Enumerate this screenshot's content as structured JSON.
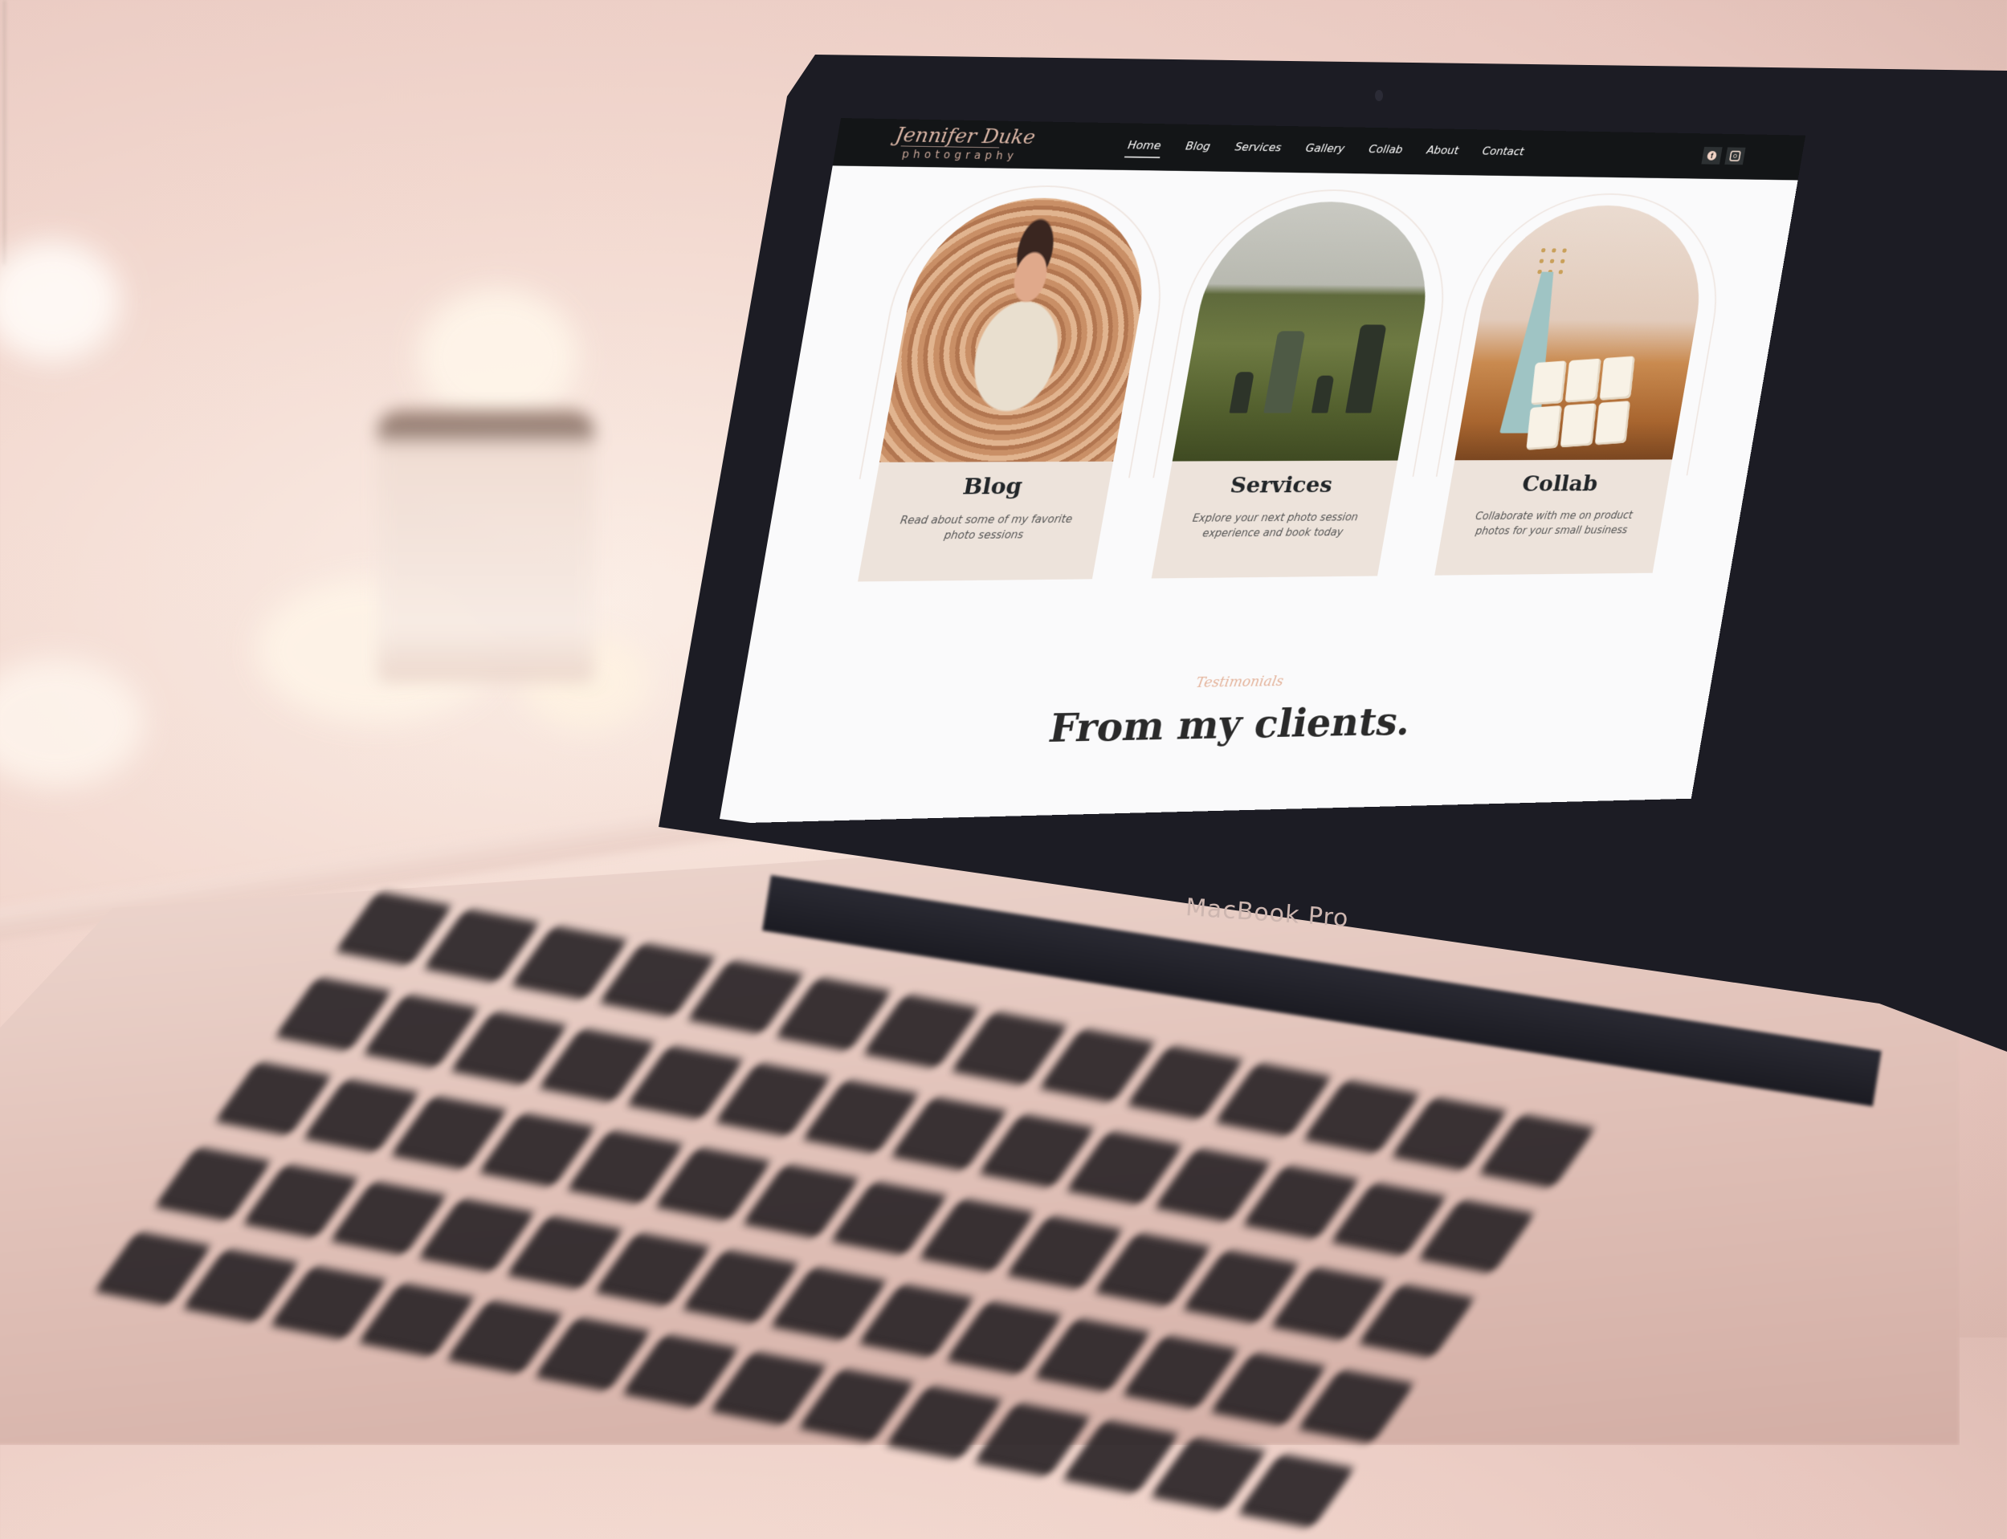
{
  "device": {
    "label": "MacBook Pro"
  },
  "site": {
    "logo": {
      "script": "Jennifer Duke",
      "sub": "photography"
    },
    "nav": {
      "items": [
        {
          "label": "Home",
          "active": true
        },
        {
          "label": "Blog",
          "active": false
        },
        {
          "label": "Services",
          "active": false
        },
        {
          "label": "Gallery",
          "active": false
        },
        {
          "label": "Collab",
          "active": false
        },
        {
          "label": "About",
          "active": false
        },
        {
          "label": "Contact",
          "active": false
        }
      ],
      "socials": [
        {
          "icon": "facebook-icon",
          "glyph": "f"
        },
        {
          "icon": "instagram-icon"
        }
      ]
    },
    "cards": [
      {
        "title": "Blog",
        "description": "Read about some of my favorite photo sessions",
        "image": "newborn-baby-photo"
      },
      {
        "title": "Services",
        "description": "Explore your next photo session experience and book today",
        "image": "family-field-photo"
      },
      {
        "title": "Collab",
        "description": "Collaborate with me on product photos for your small business",
        "image": "wax-melts-product-photo"
      }
    ],
    "testimonials": {
      "eyebrow": "Testimonials",
      "headline": "From my clients."
    }
  },
  "colors": {
    "nav_bg": "#131517",
    "accent": "#e4b49c",
    "card_panel": "#ede3db",
    "page_bg": "#fafafb"
  }
}
